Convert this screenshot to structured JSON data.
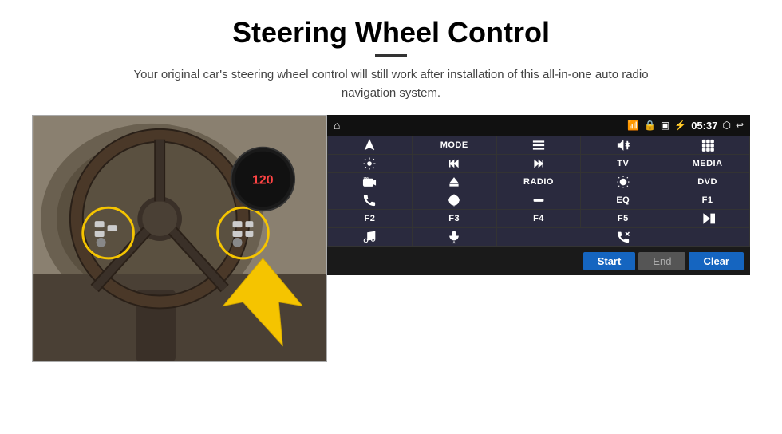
{
  "page": {
    "title": "Steering Wheel Control",
    "subtitle": "Your original car's steering wheel control will still work after installation of this all-in-one auto radio navigation system."
  },
  "status_bar": {
    "time": "05:37"
  },
  "bottom_buttons": {
    "start": "Start",
    "end": "End",
    "clear": "Clear"
  },
  "panel_buttons": [
    {
      "id": "nav",
      "type": "icon",
      "icon": "nav"
    },
    {
      "id": "mode",
      "type": "text",
      "label": "MODE"
    },
    {
      "id": "menu",
      "type": "icon",
      "icon": "menu"
    },
    {
      "id": "mute",
      "type": "icon",
      "icon": "mute"
    },
    {
      "id": "apps",
      "type": "icon",
      "icon": "apps"
    },
    {
      "id": "settings",
      "type": "icon",
      "icon": "settings"
    },
    {
      "id": "prev",
      "type": "icon",
      "icon": "prev"
    },
    {
      "id": "next",
      "type": "icon",
      "icon": "next"
    },
    {
      "id": "tv",
      "type": "text",
      "label": "TV"
    },
    {
      "id": "media",
      "type": "text",
      "label": "MEDIA"
    },
    {
      "id": "cam360",
      "type": "icon",
      "icon": "cam360"
    },
    {
      "id": "eject",
      "type": "icon",
      "icon": "eject"
    },
    {
      "id": "radio",
      "type": "text",
      "label": "RADIO"
    },
    {
      "id": "brightness",
      "type": "icon",
      "icon": "brightness"
    },
    {
      "id": "dvd",
      "type": "text",
      "label": "DVD"
    },
    {
      "id": "phone",
      "type": "icon",
      "icon": "phone"
    },
    {
      "id": "gps",
      "type": "icon",
      "icon": "gps"
    },
    {
      "id": "minimize",
      "type": "icon",
      "icon": "minimize"
    },
    {
      "id": "eq",
      "type": "text",
      "label": "EQ"
    },
    {
      "id": "f1",
      "type": "text",
      "label": "F1"
    },
    {
      "id": "f2",
      "type": "text",
      "label": "F2"
    },
    {
      "id": "f3",
      "type": "text",
      "label": "F3"
    },
    {
      "id": "f4",
      "type": "text",
      "label": "F4"
    },
    {
      "id": "f5",
      "type": "text",
      "label": "F5"
    },
    {
      "id": "play-pause",
      "type": "icon",
      "icon": "play-pause"
    },
    {
      "id": "music",
      "type": "icon",
      "icon": "music"
    },
    {
      "id": "mic",
      "type": "icon",
      "icon": "mic"
    },
    {
      "id": "call-end-span",
      "type": "icon",
      "icon": "call-end",
      "span": 3
    }
  ]
}
